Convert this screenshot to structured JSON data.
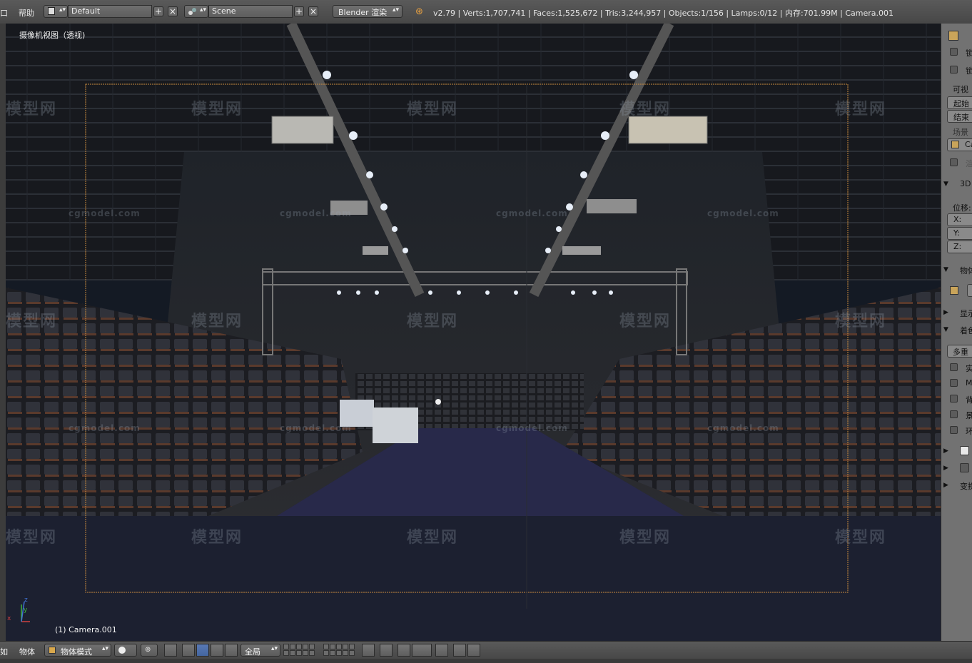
{
  "top_header": {
    "menu_left_partial": "口",
    "menu_help": "帮助",
    "layout_name": "Default",
    "scene_name": "Scene",
    "render_engine": "Blender 渲染",
    "stats": "v2.79 | Verts:1,707,741 | Faces:1,525,672 | Tris:3,244,957 | Objects:1/156 | Lamps:0/12 | 内存:701.99M | Camera.001"
  },
  "viewport": {
    "view_title": "摄像机视图（透视)",
    "camera_label": "(1) Camera.001",
    "axis_labels": {
      "x": "x",
      "y": "y",
      "z": "z"
    },
    "watermark_big": "模型网",
    "watermark_small": "cgmodel.com"
  },
  "right_panel": {
    "lock_label_1": "锁",
    "lock_label_2": "锁",
    "visible_label": "可视",
    "start_label": "起始",
    "end_label": "结束",
    "scene_label": "场景",
    "camera_short": "Ca",
    "checkbox_partial": "渲",
    "section_3d": "3D",
    "location_label": "位移:",
    "x_label": "X:",
    "y_label": "Y:",
    "z_label": "Z:",
    "section_object": "物体",
    "section_display": "显示",
    "section_shading": "着色",
    "shading_mode": "多重",
    "opt_solid": "实",
    "opt_matcap": "M",
    "opt_backface": "背",
    "opt_shadow": "景",
    "opt_ssao": "环",
    "section_transform": "变换"
  },
  "bottom_header": {
    "menu_view_partial": "如",
    "menu_object": "物体",
    "mode": "物体模式",
    "orientation": "全局"
  }
}
